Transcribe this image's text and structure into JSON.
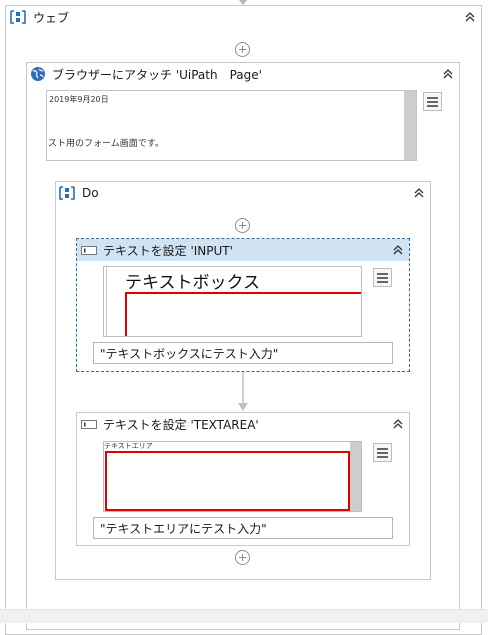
{
  "outer": {
    "title": "ウェブ"
  },
  "attach": {
    "title": "ブラウザーにアタッチ 'UiPath　Page'",
    "preview_date": "2019年9月20日",
    "preview_text": "スト用のフォーム画面です。"
  },
  "do": {
    "title": "Do"
  },
  "set_text_input": {
    "title": "テキストを設定 'INPUT'",
    "preview_text": "テキストボックス",
    "value": "\"テキストボックスにテスト入力\""
  },
  "set_text_area": {
    "title": "テキストを設定 'TEXTAREA'",
    "preview_text": "テキストエリア",
    "value": "\"テキストエリアにテスト入力\""
  },
  "colors": {
    "selected_header": "#cfe3f2",
    "selected_border": "#2e6e9e",
    "highlight_red": "#e00000"
  },
  "icons": [
    "sequence-icon",
    "globe-icon",
    "set-text-icon",
    "collapse-chevron-icon",
    "add-activity-icon",
    "hamburger-menu-icon"
  ]
}
